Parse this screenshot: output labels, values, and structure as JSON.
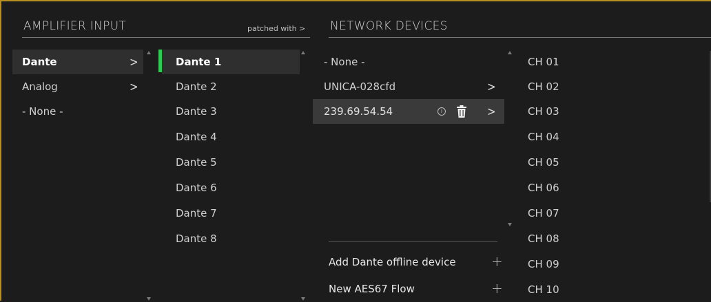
{
  "headers": {
    "amplifier_input": "AMPLIFIER INPUT",
    "patched_with": "patched with >",
    "network_devices": "NETWORK DEVICES"
  },
  "input_types": [
    {
      "label": "Dante",
      "selected": true
    },
    {
      "label": "Analog",
      "selected": false
    },
    {
      "label": "- None -",
      "selected": false
    }
  ],
  "dante_inputs": [
    "Dante 1",
    "Dante 2",
    "Dante 3",
    "Dante 4",
    "Dante 5",
    "Dante 6",
    "Dante 7",
    "Dante 8"
  ],
  "selected_dante_input": "Dante 1",
  "network_devices": [
    {
      "label": "- None -",
      "has_chevron": false
    },
    {
      "label": "UNICA-028cfd",
      "has_chevron": true
    },
    {
      "label": "239.69.54.54",
      "has_chevron": true,
      "selected": true
    }
  ],
  "actions": {
    "add_offline": "Add Dante offline device",
    "new_flow": "New AES67 Flow"
  },
  "channels": [
    "CH 01",
    "CH 02",
    "CH 03",
    "CH 04",
    "CH 05",
    "CH 06",
    "CH 07",
    "CH 08",
    "CH 09",
    "CH 10"
  ],
  "icons": {
    "chevron": "chevron-right-icon",
    "info": "info-icon",
    "trash": "trash-icon",
    "plus": "plus-icon"
  },
  "colors": {
    "accent_border": "#b89022",
    "selection_indicator": "#2ecc55",
    "background": "#1c1c1c"
  }
}
